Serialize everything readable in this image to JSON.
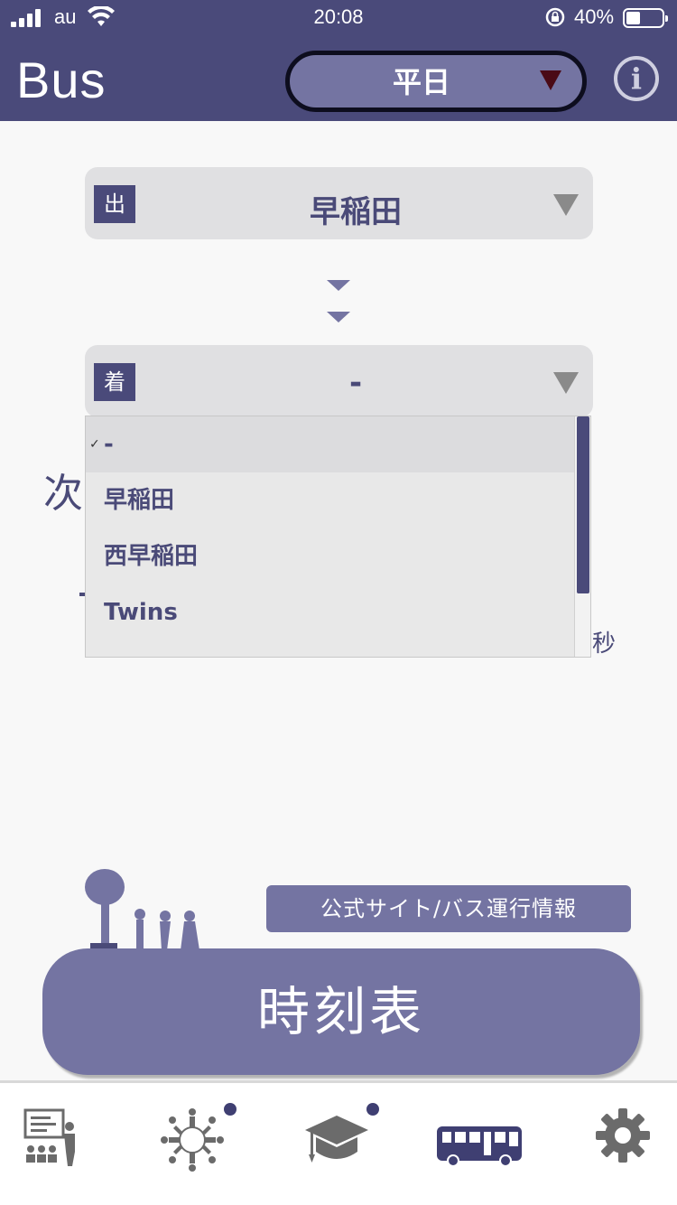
{
  "status_bar": {
    "carrier": "au",
    "time": "20:08",
    "battery_percent": "40%",
    "battery_level": 0.4
  },
  "header": {
    "title": "Bus",
    "day_selector": "平日",
    "info_icon": "info-icon"
  },
  "departure": {
    "tag": "出",
    "value": "早稲田"
  },
  "arrival": {
    "tag": "着",
    "value": "-"
  },
  "dropdown": {
    "options": [
      "-",
      "早稲田",
      "西早稲田",
      "Twins"
    ],
    "selected_index": 0
  },
  "next_bus": {
    "label_fragment": "次",
    "seconds_label": "秒"
  },
  "links": {
    "official_site": "公式サイト/バス運行情報"
  },
  "main_button": {
    "label": "時刻表"
  },
  "tabbar": {
    "items": [
      {
        "icon": "lecture-icon",
        "badge": false
      },
      {
        "icon": "community-icon",
        "badge": true
      },
      {
        "icon": "graduation-cap-icon",
        "badge": true
      },
      {
        "icon": "bus-icon",
        "badge": false,
        "active": true
      },
      {
        "icon": "gear-icon",
        "badge": false
      }
    ]
  },
  "colors": {
    "header_bg": "#4a4a7a",
    "accent": "#7474a2",
    "text": "#4a4a78"
  }
}
